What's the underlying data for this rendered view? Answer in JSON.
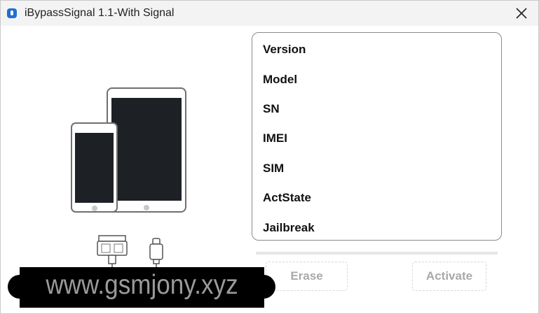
{
  "window": {
    "title": "iBypassSignal 1.1-With Signal"
  },
  "info_panel": {
    "rows": [
      "Version",
      "Model",
      "SN",
      "IMEI",
      "SIM",
      "ActState",
      "Jailbreak"
    ]
  },
  "progress": {
    "value_percent": 0
  },
  "actions": {
    "erase_label": "Erase",
    "activate_label": "Activate"
  },
  "watermark": {
    "text": "www.gsmjony.xyz"
  },
  "icons": {
    "app": "app-icon",
    "close": "close-icon"
  },
  "colors": {
    "titlebar_bg": "#f3f3f3",
    "device_screen": "#1d2025",
    "disabled_text": "#a9a9a9"
  }
}
